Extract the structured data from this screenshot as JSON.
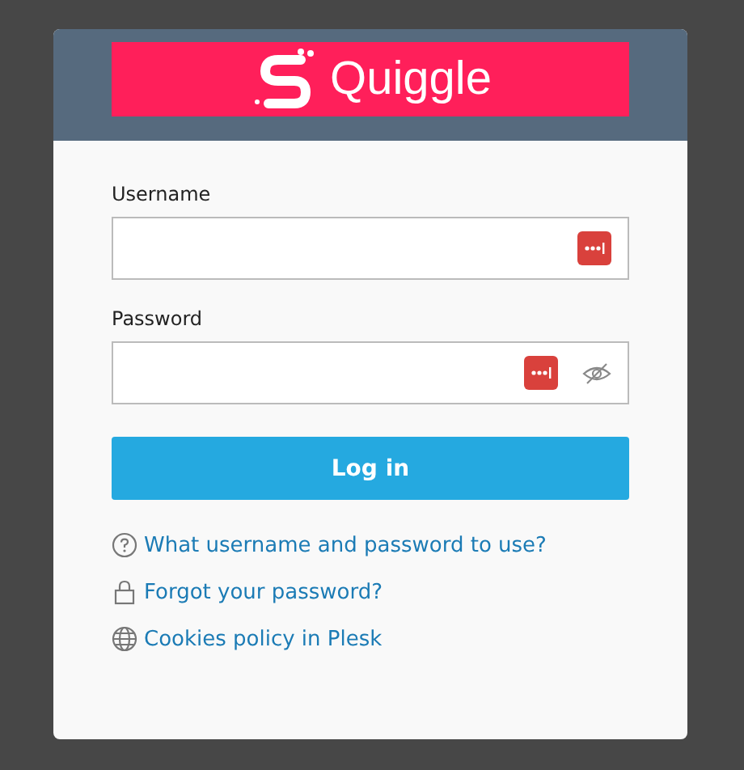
{
  "logo": {
    "text": "Quiggle"
  },
  "fields": [
    {
      "label": "Username",
      "reveal_toggle": false
    },
    {
      "label": "Password",
      "reveal_toggle": true
    }
  ],
  "login_button": "Log in",
  "links": [
    {
      "kind": "help",
      "text": "What username and password to use?"
    },
    {
      "kind": "lock",
      "text": "Forgot your password?"
    },
    {
      "kind": "globe",
      "text": "Cookies policy in Plesk"
    }
  ]
}
